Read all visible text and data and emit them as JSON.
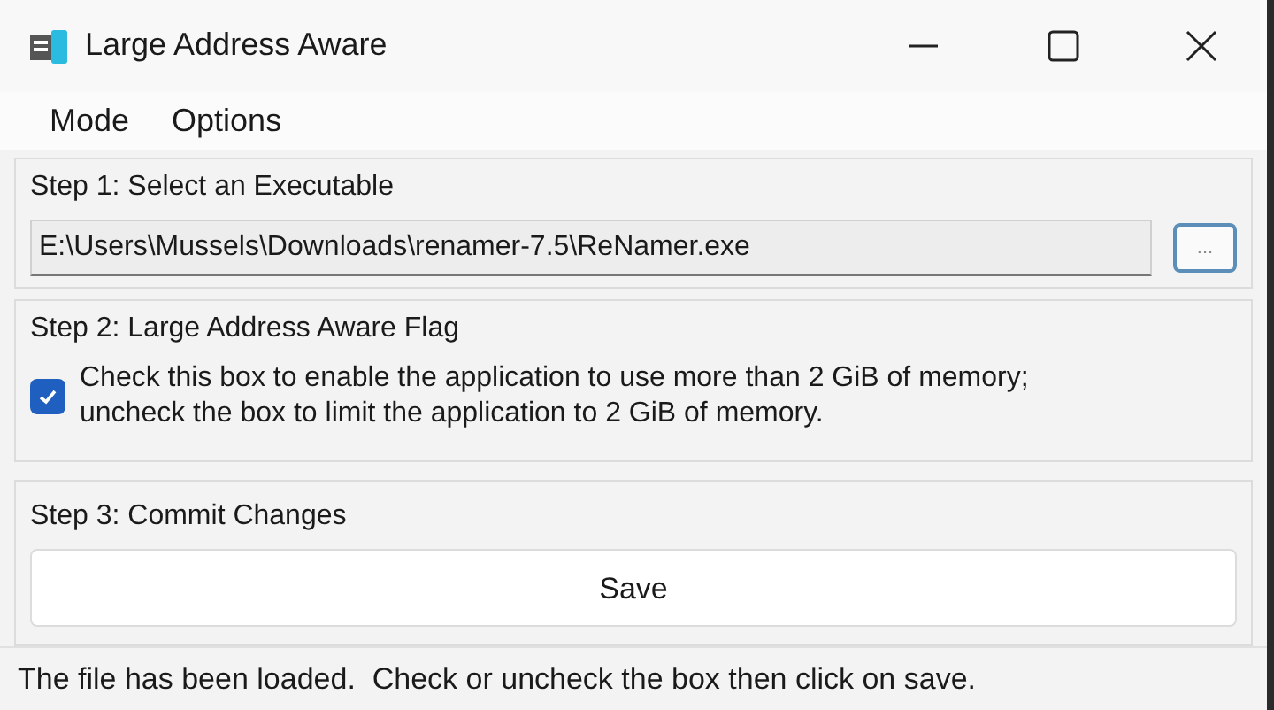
{
  "window": {
    "title": "Large Address Aware"
  },
  "menu": [
    "Mode",
    "Options"
  ],
  "step1": {
    "title": "Step 1: Select an Executable",
    "path": "E:\\Users\\Mussels\\Downloads\\renamer-7.5\\ReNamer.exe",
    "browse": "..."
  },
  "step2": {
    "title": "Step 2: Large Address Aware Flag",
    "checked": true,
    "label": "Check this box to enable the application to use more than 2 GiB of memory; uncheck the box to limit the application to 2 GiB of memory."
  },
  "step3": {
    "title": "Step 3: Commit Changes",
    "button": "Save"
  },
  "status_bar": "The file has been loaded.  Check or uncheck the box then click on save."
}
